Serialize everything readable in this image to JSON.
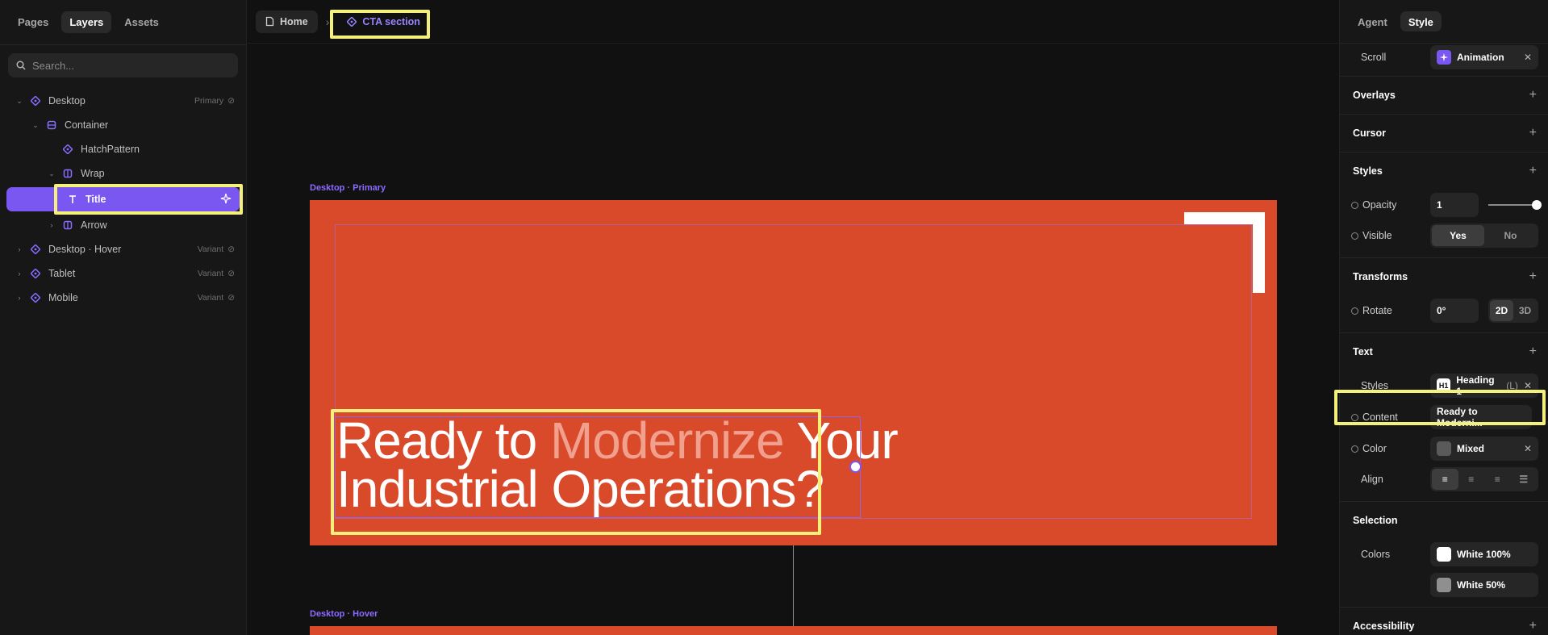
{
  "left": {
    "tabs": [
      "Pages",
      "Layers",
      "Assets"
    ],
    "search_placeholder": "Search...",
    "layers": [
      {
        "label": "Desktop",
        "tag": "Primary"
      },
      {
        "label": "Container"
      },
      {
        "label": "HatchPattern"
      },
      {
        "label": "Wrap"
      },
      {
        "label": "Title"
      },
      {
        "label": "Arrow"
      },
      {
        "label": "Desktop · Hover",
        "tag": "Variant"
      },
      {
        "label": "Tablet",
        "tag": "Variant"
      },
      {
        "label": "Mobile",
        "tag": "Variant"
      }
    ]
  },
  "breadcrumb": {
    "home": "Home",
    "current": "CTA section"
  },
  "canvas": {
    "frame1_label": "Desktop · Primary",
    "frame2_label": "Desktop · Hover",
    "title_part1": "Ready to ",
    "title_highlight": "Modernize",
    "title_part2": " Your",
    "title_line2": "Industrial Operations?"
  },
  "right": {
    "tabs": [
      "Agent",
      "Style"
    ],
    "scroll_label": "Scroll",
    "scroll_value": "Animation",
    "overlays": "Overlays",
    "cursor": "Cursor",
    "styles": "Styles",
    "opacity_label": "Opacity",
    "opacity_value": "1",
    "opacity_level": 1.0,
    "visible_label": "Visible",
    "visible_yes": "Yes",
    "visible_no": "No",
    "transforms": "Transforms",
    "rotate_label": "Rotate",
    "rotate_value": "0°",
    "mode_2d": "2D",
    "mode_3d": "3D",
    "text": "Text",
    "text_styles_label": "Styles",
    "text_style_badge": "H1",
    "text_style_value": "Heading 1",
    "text_style_size": "(L)",
    "content_label": "Content",
    "content_value": "Ready to Moderni...",
    "color_label": "Color",
    "color_value": "Mixed",
    "align_label": "Align",
    "selection": "Selection",
    "colors_label": "Colors",
    "color1": "White 100%",
    "color2": "White 50%",
    "accessibility": "Accessibility"
  }
}
